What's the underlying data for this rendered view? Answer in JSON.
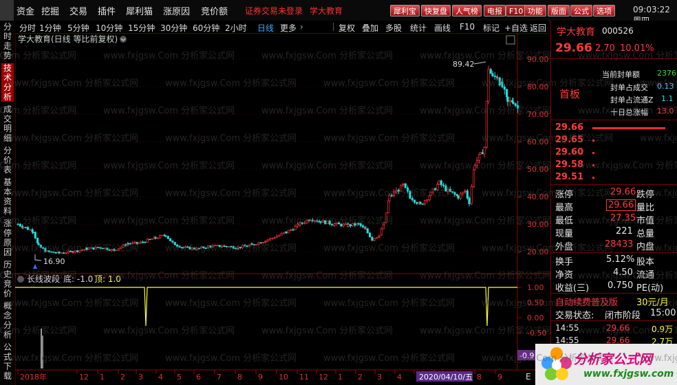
{
  "menu": {
    "items": [
      "资金",
      "挖掘",
      "交易",
      "插件",
      "犀利猫",
      "涨原因",
      "竞价额"
    ],
    "notice": "证券交易未登录",
    "notice2": "学大教育",
    "tools": [
      "犀利宝",
      "快复盘",
      "人气榜",
      "电报",
      "F10",
      "功能",
      "版面",
      "公式",
      "选项"
    ],
    "clock": "09:03:22 周四"
  },
  "left_tabs": [
    "分时走势",
    "技术分析",
    "成交明细",
    "分价表",
    "基本资料",
    "涨停原因",
    "历史竞价",
    "概念分析",
    "公式下载"
  ],
  "toolbar": {
    "periods": [
      "分时",
      "1分钟",
      "5分钟",
      "10分钟",
      "15分钟",
      "30分钟",
      "60分钟",
      "2小时",
      "日线",
      "更多"
    ],
    "selected": "日线",
    "right_tools": [
      "复权",
      "叠加",
      "多股",
      "统计",
      "画线",
      "F10",
      "标记",
      "+自选",
      "返回"
    ]
  },
  "chart": {
    "title": "学大教育(日线 等比前复权)",
    "high_label": "89.42",
    "low_label": "16.90",
    "price_ticks": [
      "90.00",
      "80.00",
      "70.00",
      "60.00",
      "50.00",
      "40.00",
      "30.00",
      "20.00"
    ],
    "indicator_title": "长线波段",
    "indicator_params": "底: -1.0",
    "indicator_params2": "顶: 1.0",
    "ind_ticks": [
      "1.00",
      "0.50",
      "0.00",
      "-0.50"
    ],
    "ind_badge": "-0.9",
    "x_labels": [
      "2018年",
      "12",
      "1",
      "2",
      "3",
      "4",
      "5",
      "6",
      "7",
      "8",
      "9",
      "10",
      "11",
      "12",
      "1",
      "2",
      "3",
      "4",
      "5",
      "6",
      "7",
      "8",
      "9"
    ],
    "cursor_date": "2020/04/10/五",
    "corner_label": "E"
  },
  "chart_data": {
    "type": "candlestick",
    "y_axis_range": [
      16,
      92
    ],
    "high": 89.42,
    "low": 16.9
  },
  "stock": {
    "name": "学大教育",
    "code": "000526",
    "price": "29.66",
    "change": "2.70",
    "pct": "10.01%",
    "limit_label": "首板",
    "seal_rows": [
      {
        "label": "当前封单额",
        "value": "2376"
      },
      {
        "label": "封单占成交",
        "value": "0.13"
      },
      {
        "label": "封单占流通Z",
        "value": "1.1"
      },
      {
        "label": "十日总涨幅",
        "value": "13.0"
      }
    ],
    "order_book": [
      "29.66",
      "29.65",
      "29.60",
      "29.58",
      "29.51"
    ],
    "stats": [
      {
        "k": "涨停",
        "v": "29.66",
        "k2": "跌停"
      },
      {
        "k": "最高",
        "v": "29.66",
        "k2": "量比"
      },
      {
        "k": "最低",
        "v": "27.35",
        "k2": "市值"
      },
      {
        "k": "现量",
        "v": "221",
        "k2": "总量"
      },
      {
        "k": "外盘",
        "v": "28433",
        "k2": "内盘"
      }
    ],
    "stats2": [
      {
        "k": "换手",
        "v": "5.12%",
        "k2": "股本"
      },
      {
        "k": "净资",
        "v": "4.50",
        "k2": "流通"
      },
      {
        "k": "收益(三)",
        "v": "0.750",
        "k2": "PE(动)"
      }
    ],
    "promo": "自动续费普及版",
    "promo_price": "30元/月",
    "status_label": "交易状态:",
    "status_value": "闭市阶段",
    "status_time": "15:00",
    "trades": [
      {
        "t": "14:55",
        "p": "29.66",
        "v": "0.9万"
      },
      {
        "t": "14:55",
        "p": "29.66",
        "v": "2.7万"
      }
    ]
  },
  "watermark": {
    "logo_text": "分析家公式网",
    "logo_url": "www.fxjgsw.com"
  }
}
